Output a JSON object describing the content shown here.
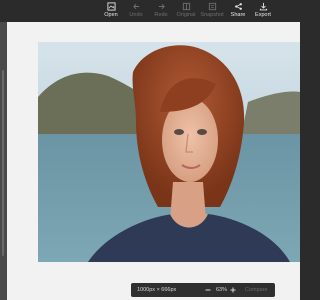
{
  "toolbar": {
    "open_label": "Open",
    "undo_label": "Undo",
    "redo_label": "Redo",
    "original_label": "Original",
    "snapshot_label": "Snapshot",
    "share_label": "Share",
    "export_label": "Export"
  },
  "canvas": {
    "image_dimensions": "1000px × 666px",
    "zoom_level": "63%",
    "compare_label": "Compare"
  }
}
